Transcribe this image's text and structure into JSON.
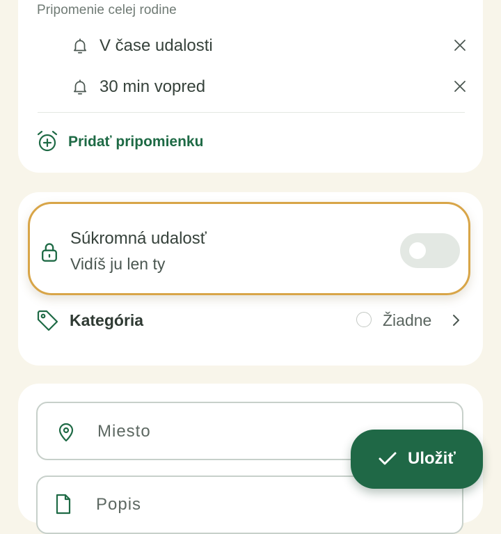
{
  "reminders": {
    "section_label": "Pripomenie celej rodine",
    "items": [
      {
        "label": "V čase udalosti"
      },
      {
        "label": "30 min vopred"
      }
    ],
    "add_label": "Pridať pripomienku"
  },
  "privacy": {
    "title": "Súkromná udalosť",
    "subtitle": "Vidíš ju len ty",
    "enabled": false
  },
  "category": {
    "label": "Kategória",
    "value": "Žiadne"
  },
  "location": {
    "placeholder": "Miesto"
  },
  "description": {
    "visible_text": "Popis"
  },
  "save": {
    "label": "Uložiť"
  },
  "colors": {
    "accent": "#1f6846",
    "highlight_border": "#d8a548",
    "background": "#f8f5ea"
  },
  "icons": [
    "bell-icon",
    "close-icon",
    "alarm-add-icon",
    "lock-icon",
    "tag-icon",
    "chevron-right-icon",
    "location-pin-icon",
    "document-icon",
    "check-icon"
  ]
}
